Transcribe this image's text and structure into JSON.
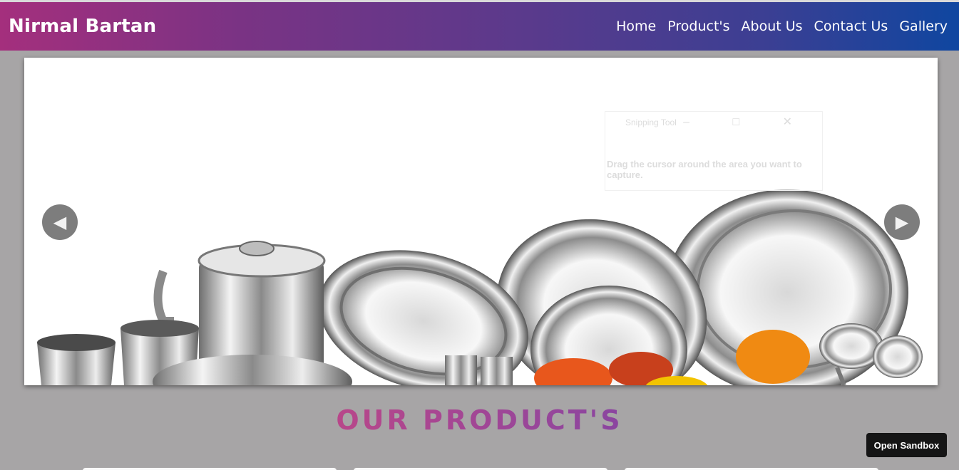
{
  "navbar": {
    "brand": "Nirmal Bartan",
    "links": [
      "Home",
      "Product's",
      "About Us",
      "Contact Us",
      "Gallery"
    ]
  },
  "carousel": {
    "prev_icon": "◀",
    "next_icon": "▶",
    "overlay": {
      "title": "Snipping Tool",
      "controls": "– □ ✕",
      "text": "Drag the cursor around the area you want to capture."
    }
  },
  "products": {
    "title": "OUR PRODUCT'S"
  },
  "sandbox": {
    "label": "Open Sandbox"
  },
  "colors": {
    "nav_gradient_start": "#a42f7d",
    "nav_gradient_end": "#0f46a0",
    "page_background": "#a7a5a6",
    "title_color": "#b04a8e"
  }
}
